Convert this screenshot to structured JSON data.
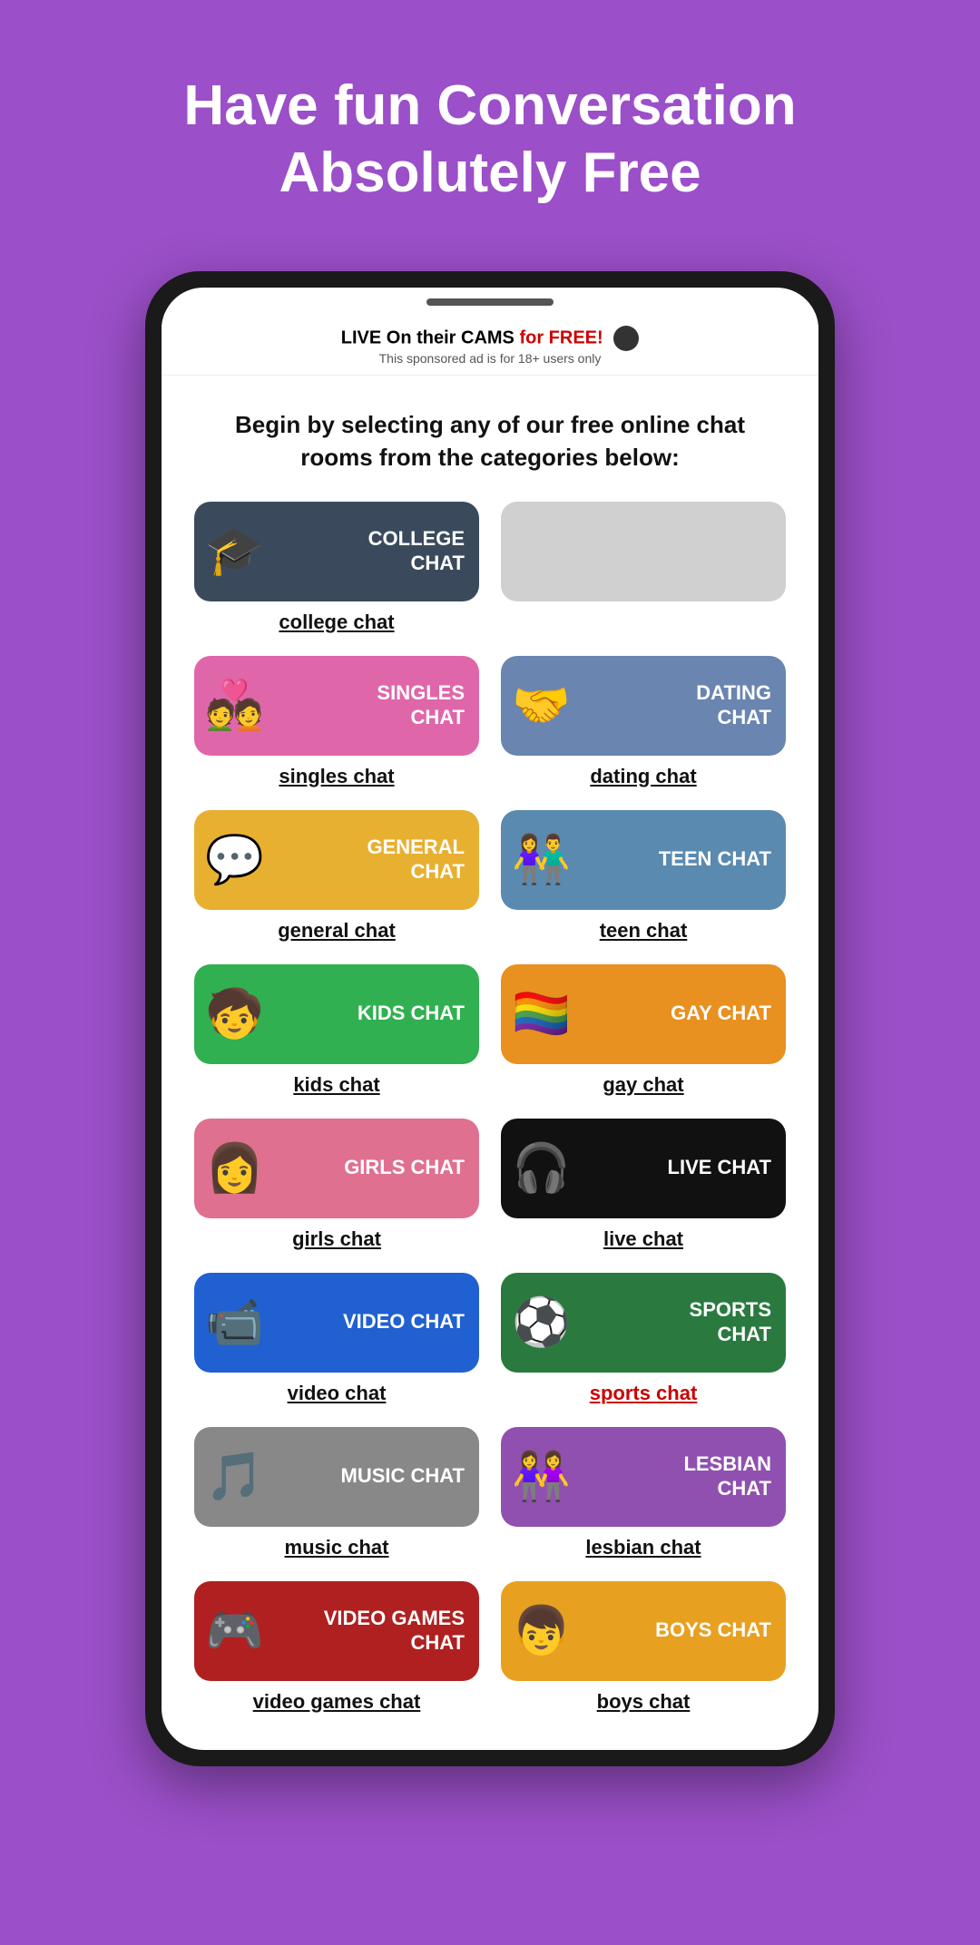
{
  "header": {
    "title": "Have fun Conversation Absolutely Free"
  },
  "ad": {
    "main_before": "LIVE On their CAMS ",
    "main_highlight": "for FREE!",
    "sub": "This sponsored ad is for 18+ users only"
  },
  "intro": "Begin by selecting any of our free online chat rooms from the categories below:",
  "chats": [
    {
      "id": "college",
      "label": "COLLEGE\nCHAT",
      "link": "college chat",
      "color": "btn-college",
      "icon": "🎓",
      "red": false
    },
    {
      "id": "placeholder",
      "label": "",
      "link": "",
      "color": "btn-placeholder",
      "icon": "",
      "red": false
    },
    {
      "id": "singles",
      "label": "SINGLES\nCHAT",
      "link": "singles chat",
      "color": "btn-singles",
      "icon": "💑",
      "red": false
    },
    {
      "id": "dating",
      "label": "DATING\nCHAT",
      "link": "dating chat",
      "color": "btn-dating",
      "icon": "🤝",
      "red": false
    },
    {
      "id": "general",
      "label": "GENERAL\nCHAT",
      "link": "general chat",
      "color": "btn-general",
      "icon": "💬",
      "red": false
    },
    {
      "id": "teen",
      "label": "TEEN CHAT",
      "link": "teen chat",
      "color": "btn-teen",
      "icon": "👫",
      "red": false
    },
    {
      "id": "kids",
      "label": "KIDS CHAT",
      "link": "kids chat",
      "color": "btn-kids",
      "icon": "🧒",
      "red": false
    },
    {
      "id": "gay",
      "label": "GAY CHAT",
      "link": "gay chat",
      "color": "btn-gay",
      "icon": "🏳️‍🌈",
      "red": false
    },
    {
      "id": "girls",
      "label": "GIRLS CHAT",
      "link": "girls chat",
      "color": "btn-girls",
      "icon": "👩",
      "red": false
    },
    {
      "id": "live",
      "label": "LIVE CHAT",
      "link": "live chat",
      "color": "btn-live",
      "icon": "🎧",
      "red": false
    },
    {
      "id": "video",
      "label": "VIDEO CHAT",
      "link": "video chat",
      "color": "btn-video",
      "icon": "📹",
      "red": false
    },
    {
      "id": "sports",
      "label": "SPORTS\nCHAT",
      "link": "sports chat",
      "color": "btn-sports",
      "icon": "⚽",
      "red": true
    },
    {
      "id": "music",
      "label": "MUSIC CHAT",
      "link": "music chat",
      "color": "btn-music",
      "icon": "🎵",
      "red": false
    },
    {
      "id": "lesbian",
      "label": "LESBIAN\nCHAT",
      "link": "lesbian chat",
      "color": "btn-lesbian",
      "icon": "👭",
      "red": false
    },
    {
      "id": "videogames",
      "label": "VIDEO GAMES\nCHAT",
      "link": "video games chat",
      "color": "btn-videogames",
      "icon": "🎮",
      "red": false
    },
    {
      "id": "boys",
      "label": "BOYS CHAT",
      "link": "boys chat",
      "color": "btn-boys",
      "icon": "👦",
      "red": false
    }
  ]
}
